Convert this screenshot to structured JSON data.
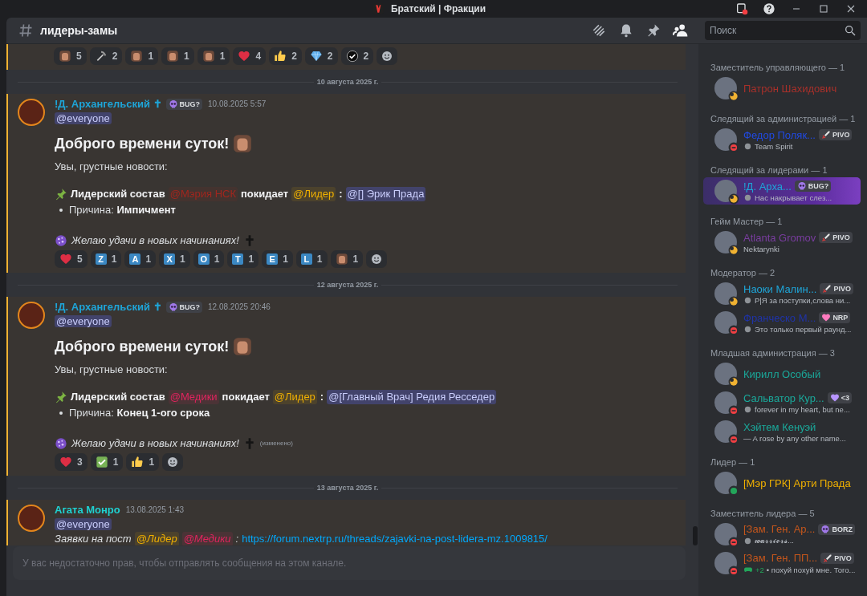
{
  "window": {
    "title": "Братский | Фракции"
  },
  "header": {
    "channel": "лидеры-замы",
    "member_list_open": true
  },
  "search": {
    "placeholder": "Поиск"
  },
  "feed": [
    {
      "kind": "tail",
      "reactions": [
        {
          "kind": "sticker",
          "count": "5"
        },
        {
          "kind": "tool",
          "count": "2"
        },
        {
          "kind": "sticker",
          "count": "1"
        },
        {
          "kind": "sticker",
          "count": "1"
        },
        {
          "kind": "sticker",
          "count": "1"
        },
        {
          "kind": "heart",
          "count": "4"
        },
        {
          "kind": "thumbs",
          "count": "2"
        },
        {
          "kind": "gem",
          "count": "2"
        },
        {
          "kind": "rosette",
          "count": "2"
        }
      ]
    },
    {
      "kind": "divider",
      "text": "10 августа 2025 г."
    },
    {
      "kind": "message",
      "mentioned": true,
      "author": {
        "name": "!Д. Архангельский ✝",
        "color": "#1ea5d8"
      },
      "tag": {
        "kind": "skull",
        "label": "BUG?"
      },
      "time": "10.08.2025 5:57",
      "mention": "@everyone",
      "blocks": [
        {
          "kind": "heading",
          "text": "Доброго времени суток!"
        },
        {
          "kind": "paragraph",
          "text": "Увы, грустные новости:"
        },
        {
          "kind": "announce",
          "parts": [
            {
              "kind": "bold",
              "text": "Лидерский состав"
            },
            {
              "kind": "role",
              "text": "@Мэрия НСК",
              "color": "#a0261e"
            },
            {
              "kind": "bold",
              "text": "покидает"
            },
            {
              "kind": "role",
              "text": "@Лидер",
              "color": "#f0b000"
            },
            {
              "kind": "bold",
              "text": ":"
            },
            {
              "kind": "user",
              "text": "@[] Эрик Прада"
            }
          ]
        },
        {
          "kind": "bullet",
          "text": "Причина: **Импичмент**"
        },
        {
          "kind": "farewell",
          "text": "Желаю удачи в новых начинаниях!"
        }
      ],
      "reactions": [
        {
          "kind": "heart",
          "count": "5"
        },
        {
          "kind": "letter",
          "letter": "Z",
          "count": "1"
        },
        {
          "kind": "letter",
          "letter": "A",
          "count": "1"
        },
        {
          "kind": "letter",
          "letter": "X",
          "count": "1"
        },
        {
          "kind": "letter",
          "letter": "O",
          "count": "1"
        },
        {
          "kind": "letter",
          "letter": "T",
          "count": "1"
        },
        {
          "kind": "letter",
          "letter": "E",
          "count": "1"
        },
        {
          "kind": "letter",
          "letter": "L",
          "count": "1"
        },
        {
          "kind": "sticker",
          "count": "1"
        }
      ]
    },
    {
      "kind": "divider",
      "text": "12 августа 2025 г."
    },
    {
      "kind": "message",
      "mentioned": true,
      "author": {
        "name": "!Д. Архангельский ✝",
        "color": "#1ea5d8"
      },
      "tag": {
        "kind": "skull",
        "label": "BUG?"
      },
      "time": "12.08.2025 20:46",
      "mention": "@everyone",
      "blocks": [
        {
          "kind": "heading",
          "text": "Доброго времени суток!"
        },
        {
          "kind": "paragraph",
          "text": "Увы, грустные новости:"
        },
        {
          "kind": "announce",
          "parts": [
            {
              "kind": "bold",
              "text": "Лидерский состав"
            },
            {
              "kind": "role",
              "text": "@Медики",
              "color": "#e0245e"
            },
            {
              "kind": "bold",
              "text": "покидает"
            },
            {
              "kind": "role",
              "text": "@Лидер",
              "color": "#f0b000"
            },
            {
              "kind": "bold",
              "text": ":"
            },
            {
              "kind": "user",
              "text": "@[Главный Врач] Редия Ресседер"
            }
          ]
        },
        {
          "kind": "bullet",
          "text": "Причина: **Конец 1-ого срока**"
        },
        {
          "kind": "farewell",
          "text": "Желаю удачи в новых начинаниях!",
          "edited": "(изменено)"
        }
      ],
      "reactions": [
        {
          "kind": "heart",
          "count": "3"
        },
        {
          "kind": "check",
          "count": "1"
        },
        {
          "kind": "thumbs",
          "count": "1"
        }
      ]
    },
    {
      "kind": "divider",
      "text": "13 августа 2025 г."
    },
    {
      "kind": "message",
      "mentioned": true,
      "author": {
        "name": "Агата Монро",
        "color": "#1fd1d1"
      },
      "time": "13.08.2025 1:43",
      "mention": "@everyone",
      "blocks": [
        {
          "kind": "line",
          "parts": [
            {
              "kind": "italic",
              "text": "Заявки на пост"
            },
            {
              "kind": "role",
              "text": "@Лидер",
              "color": "#f0b000",
              "italic": true
            },
            {
              "kind": "role",
              "text": "@Медики",
              "color": "#e0245e",
              "italic": true
            },
            {
              "kind": "italic",
              "text": ":"
            },
            {
              "kind": "link",
              "text": "https://forum.nextrp.ru/threads/zajavki-na-post-lidera-mz.1009815/"
            }
          ]
        }
      ]
    }
  ],
  "composer": {
    "placeholder": "У вас недостаточно прав, чтобы отправлять сообщения на этом канале.",
    "disabled": true
  },
  "member_groups": [
    {
      "title": "Заместитель управляющего — 1",
      "members": [
        {
          "name": "Патрон Шахидович",
          "color": "#a8302a",
          "status": {
            "kind": "idle",
            "color": "#f0b232"
          }
        }
      ]
    },
    {
      "title": "Следящий за администрацией — 1",
      "members": [
        {
          "name": "Федор Поляк...",
          "color": "#2049e0",
          "status": {
            "kind": "dnd",
            "color": "#f23f43"
          },
          "tag": {
            "kind": "sword",
            "label": "PIVO"
          },
          "activity": {
            "kind": "emoji",
            "text": "Team Spirit"
          }
        }
      ]
    },
    {
      "title": "Следящий за лидерами — 1",
      "members": [
        {
          "name": "!Д. Арха...",
          "color": "#1ea5d8",
          "status": {
            "kind": "idle",
            "color": "#f0b232"
          },
          "nameplate": true,
          "tag": {
            "kind": "skull",
            "label": "BUG?"
          },
          "activity": {
            "kind": "emoji",
            "text": "Нас накрывает слез..."
          }
        }
      ]
    },
    {
      "title": "Гейм Мастер — 1",
      "members": [
        {
          "name": "Atlanta Gromov",
          "color": "#7a3da0",
          "status": {
            "kind": "idle",
            "color": "#f0b232"
          },
          "tag": {
            "kind": "sword",
            "label": "PIVO"
          },
          "activity": {
            "kind": "plain",
            "text": "Nektarynki"
          }
        }
      ]
    },
    {
      "title": "Модератор — 2",
      "members": [
        {
          "name": "Наоки Малин...",
          "color": "#1ea5d8",
          "status": {
            "kind": "idle",
            "color": "#f0b232"
          },
          "tag": {
            "kind": "sword",
            "label": "PIVO"
          },
          "activity": {
            "kind": "emoji",
            "text": "P|Я за поступки,слова ни..."
          }
        },
        {
          "name": "Франческо М...",
          "color": "#1f33a8",
          "status": {
            "kind": "dnd",
            "color": "#f23f43"
          },
          "tag": {
            "kind": "heart",
            "label": "NRP"
          },
          "activity": {
            "kind": "emoji",
            "text": "Это только первый раунд..."
          }
        }
      ]
    },
    {
      "title": "Младшая администрация — 3",
      "members": [
        {
          "name": "Кирилл Особый",
          "color": "#1aa89a",
          "status": {
            "kind": "idle",
            "color": "#f0b232"
          }
        },
        {
          "name": "Сальватор Кур...",
          "color": "#1aa89a",
          "status": {
            "kind": "dnd",
            "color": "#f23f43"
          },
          "tag": {
            "kind": "gem",
            "label": "<3"
          },
          "activity": {
            "kind": "emoji",
            "text": "forever in my heart, but ne..."
          }
        },
        {
          "name": "Хэйтем Кенуэй",
          "color": "#1aa89a",
          "status": {
            "kind": "dnd",
            "color": "#f23f43"
          },
          "activity": {
            "kind": "plain",
            "text": "— A rose by any other name..."
          }
        }
      ]
    },
    {
      "title": "Лидер — 1",
      "members": [
        {
          "name": "[Мэр ГРК] Арти Прада",
          "color": "#f0b000",
          "status": {
            "kind": "online",
            "color": "#23a55a"
          }
        }
      ]
    },
    {
      "title": "Заместитель лидера — 5",
      "members": [
        {
          "name": "[Зам. Ген. Ар...",
          "color": "#c4561c",
          "status": {
            "kind": "dnd",
            "color": "#f23f43"
          },
          "tag": {
            "kind": "skull",
            "label": "BORZ"
          },
          "activity": {
            "kind": "emoji",
            "text": "𝔀𝓪𝓻𝓻𝓲𝓸𝓻𝓼..."
          }
        },
        {
          "name": "[Зам. Ген. ПП...",
          "color": "#c4561c",
          "status": {
            "kind": "dnd",
            "color": "#f23f43"
          },
          "tag": {
            "kind": "sword",
            "label": "PIVO"
          },
          "activity": {
            "kind": "game",
            "count": "+2",
            "text": "• похуй похуй мне. Того..."
          }
        }
      ]
    }
  ]
}
